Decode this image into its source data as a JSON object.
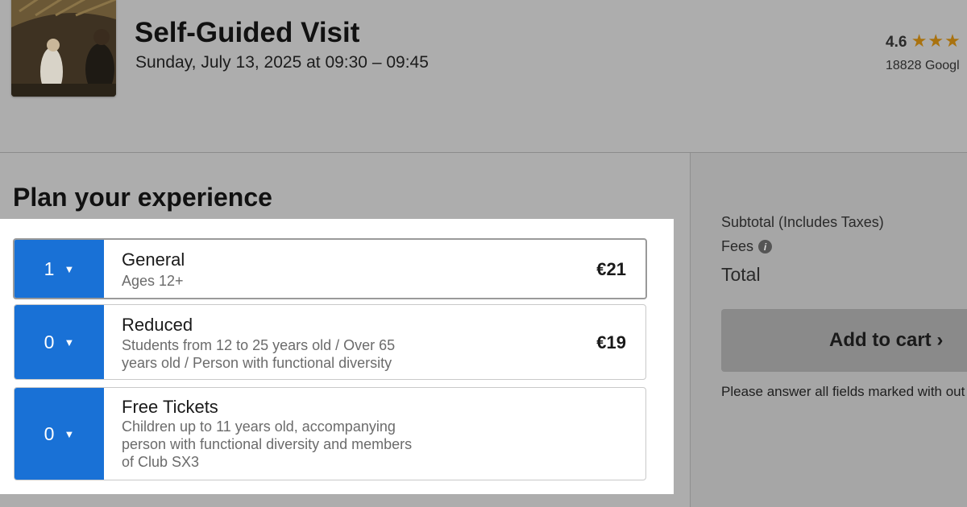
{
  "header": {
    "title": "Self-Guided Visit",
    "datetime": "Sunday, July 13, 2025 at 09:30 – 09:45",
    "rating": {
      "score": "4.6",
      "stars": "★★★",
      "reviews": "18828 Googl"
    }
  },
  "main": {
    "plan_title": "Plan your experience",
    "tickets": [
      {
        "quantity": "1",
        "name": "General",
        "description": "Ages 12+",
        "price": "€21",
        "selected": true
      },
      {
        "quantity": "0",
        "name": "Reduced",
        "description": "Students from 12 to 25 years old / Over 65 years old / Person with functional diversity",
        "price": "€19",
        "selected": false
      },
      {
        "quantity": "0",
        "name": "Free Tickets",
        "description": "Children up to 11 years old, accompanying person with functional diversity and members of Club SX3",
        "price": "",
        "selected": false
      }
    ]
  },
  "sidebar": {
    "subtotal_label": "Subtotal (Includes Taxes)",
    "fees_label": "Fees",
    "total_label": "Total",
    "add_to_cart": "Add to cart ›",
    "notice": "Please answer all fields marked with out"
  },
  "icons": {
    "caret": "caret-down-icon",
    "info": "info-icon",
    "star": "star-icon"
  },
  "colors": {
    "accent": "#1971d6",
    "star": "#a9720f",
    "overlay": "#adadad"
  }
}
